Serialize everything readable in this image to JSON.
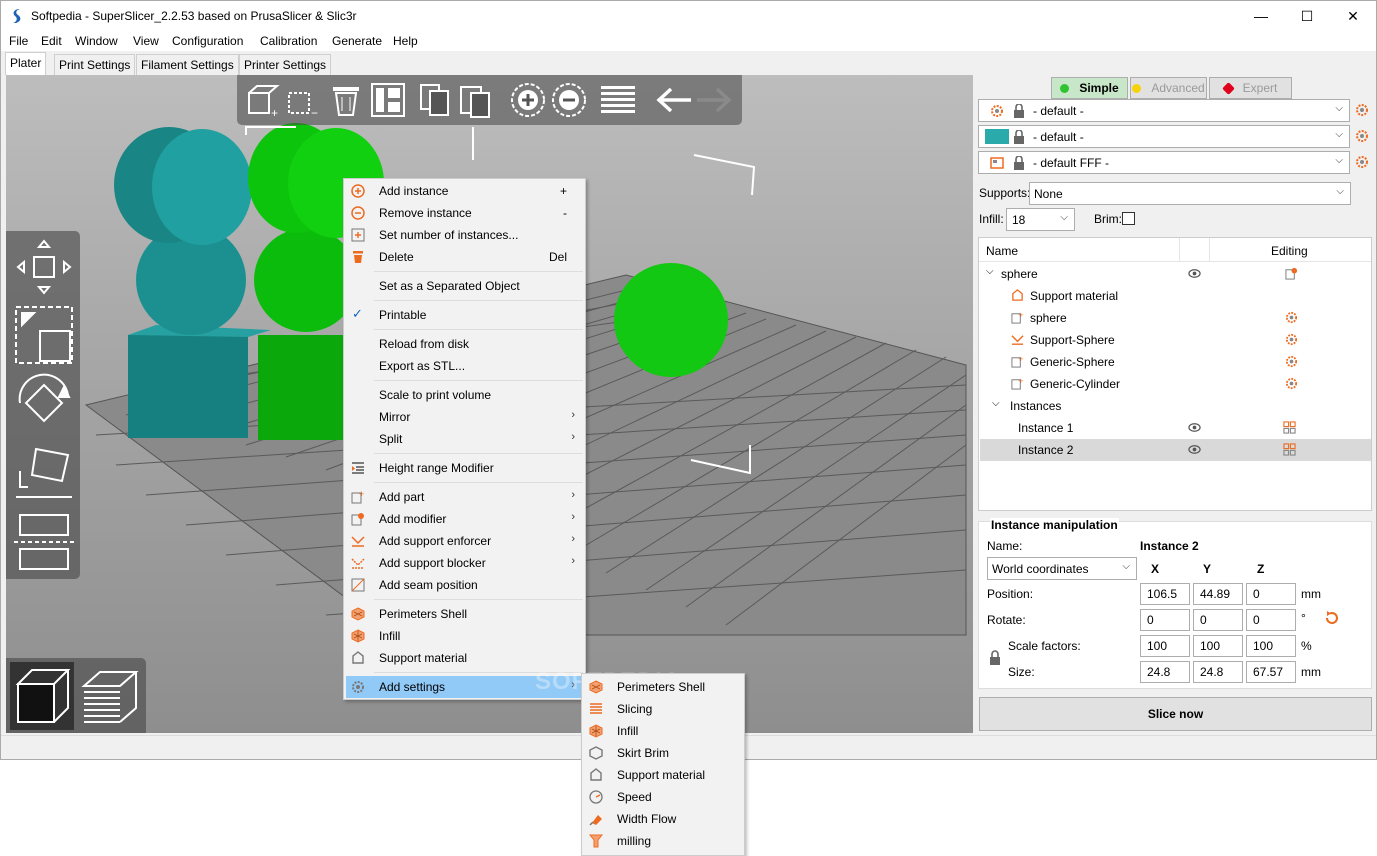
{
  "window": {
    "title": "Softpedia - SuperSlicer_2.2.53 based on PrusaSlicer & Slic3r",
    "minimize": "—",
    "maximize": "☐",
    "close": "✕"
  },
  "menu": [
    "File",
    "Edit",
    "Window",
    "View",
    "Configuration",
    "Calibration",
    "Generate",
    "Help"
  ],
  "tabs": [
    "Plater",
    "Print Settings",
    "Filament Settings",
    "Printer Settings"
  ],
  "active_tab": "Plater",
  "context_menu": {
    "items": [
      {
        "label": "Add instance",
        "accel": "+",
        "icon": "add-circle-icon"
      },
      {
        "label": "Remove instance",
        "accel": "-",
        "icon": "remove-circle-icon"
      },
      {
        "label": "Set number of instances...",
        "icon": "instances-icon"
      },
      {
        "label": "Delete",
        "accel": "Del",
        "icon": "trash-icon"
      },
      {
        "label": "Set as a Separated Object"
      },
      {
        "label": "Printable",
        "checked": true
      },
      {
        "label": "Reload from disk"
      },
      {
        "label": "Export as STL..."
      },
      {
        "label": "Scale to print volume"
      },
      {
        "label": "Mirror",
        "submenu": true
      },
      {
        "label": "Split",
        "submenu": true
      },
      {
        "label": "Height range Modifier",
        "icon": "height-range-icon"
      },
      {
        "label": "Add part",
        "submenu": true,
        "icon": "add-part-icon"
      },
      {
        "label": "Add modifier",
        "submenu": true,
        "icon": "add-modifier-icon"
      },
      {
        "label": "Add support enforcer",
        "submenu": true,
        "icon": "support-enforcer-icon"
      },
      {
        "label": "Add support blocker",
        "submenu": true,
        "icon": "support-blocker-icon"
      },
      {
        "label": "Add seam position",
        "icon": "seam-icon"
      },
      {
        "label": "Perimeters  Shell",
        "icon": "perimeters-icon"
      },
      {
        "label": "Infill",
        "icon": "infill-icon"
      },
      {
        "label": "Support material",
        "icon": "support-material-icon"
      },
      {
        "label": "Add settings",
        "submenu": true,
        "icon": "settings-gear-icon",
        "highlighted": true
      }
    ]
  },
  "submenu": {
    "items": [
      {
        "label": "Perimeters  Shell",
        "icon": "perimeters-icon"
      },
      {
        "label": "Slicing",
        "icon": "slicing-icon"
      },
      {
        "label": "Infill",
        "icon": "infill-icon"
      },
      {
        "label": "Skirt  Brim",
        "icon": "skirt-icon"
      },
      {
        "label": "Support material",
        "icon": "support-material-icon"
      },
      {
        "label": "Speed",
        "icon": "speed-icon"
      },
      {
        "label": "Width  Flow",
        "icon": "flow-icon"
      },
      {
        "label": "milling",
        "icon": "milling-icon"
      }
    ]
  },
  "mode": {
    "simple": "Simple",
    "advanced": "Advanced",
    "expert": "Expert"
  },
  "colors": {
    "simple": "#2fc42f",
    "advanced": "#f5d20a",
    "expert": "#e0001b",
    "teal": "#2aaaaa",
    "accent_orange": "#ed6b21",
    "green_obj": "#12c812",
    "teal_obj": "#1a8c8c"
  },
  "presets": {
    "print": "- default -",
    "filament": "- default -",
    "printer": "- default FFF -"
  },
  "supports": {
    "label": "Supports:",
    "value": "None"
  },
  "infill": {
    "label": "Infill:",
    "value": "18"
  },
  "brim": {
    "label": "Brim:"
  },
  "tree": {
    "col_name": "Name",
    "col_editing": "Editing",
    "rows": [
      {
        "label": "sphere",
        "level": 0
      },
      {
        "label": "Support material",
        "level": 1
      },
      {
        "label": "sphere",
        "level": 1
      },
      {
        "label": "Support-Sphere",
        "level": 1
      },
      {
        "label": "Generic-Sphere",
        "level": 1
      },
      {
        "label": "Generic-Cylinder",
        "level": 1
      },
      {
        "label": "Instances",
        "level": 1
      },
      {
        "label": "Instance 1",
        "level": 2
      },
      {
        "label": "Instance 2",
        "level": 2
      }
    ]
  },
  "manipulation": {
    "title": "Instance manipulation",
    "name_label": "Name:",
    "name_value": "Instance 2",
    "coords": "World coordinates",
    "x": "X",
    "y": "Y",
    "z": "Z",
    "position_label": "Position:",
    "position": [
      "106.5",
      "44.89",
      "0"
    ],
    "position_unit": "mm",
    "rotate_label": "Rotate:",
    "rotate": [
      "0",
      "0",
      "0"
    ],
    "rotate_unit": "°",
    "scale_label": "Scale factors:",
    "scale": [
      "100",
      "100",
      "100"
    ],
    "scale_unit": "%",
    "size_label": "Size:",
    "size": [
      "24.8",
      "24.8",
      "67.57"
    ],
    "size_unit": "mm"
  },
  "slice_button": "Slice now",
  "watermark": "SOFTPEDIA"
}
